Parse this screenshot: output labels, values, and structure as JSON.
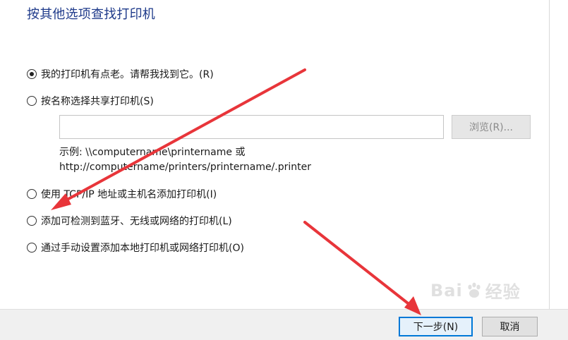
{
  "dialog": {
    "title": "按其他选项查找打印机"
  },
  "options": [
    {
      "label": "我的打印机有点老。请帮我找到它。(R)",
      "selected": true
    },
    {
      "label": "按名称选择共享打印机(S)",
      "selected": false
    },
    {
      "label": "使用 TCP/IP 地址或主机名添加打印机(I)",
      "selected": false
    },
    {
      "label": "添加可检测到蓝牙、无线或网络的打印机(L)",
      "selected": false
    },
    {
      "label": "通过手动设置添加本地打印机或网络打印机(O)",
      "selected": false
    }
  ],
  "share_name": {
    "value": "",
    "browse_label": "浏览(R)...",
    "example_line1": "示例: \\\\computername\\printername 或",
    "example_line2": "http://computername/printers/printername/.printer"
  },
  "footer": {
    "next_label": "下一步(N)",
    "cancel_label": "取消"
  },
  "watermark": {
    "text_left": "Bai",
    "text_right": "经验"
  },
  "annotation": {
    "arrow_color": "#e8353a"
  },
  "colors": {
    "title": "#1e3a8a",
    "focus_border": "#0078d7",
    "footer_bg": "#f0f0f0"
  }
}
